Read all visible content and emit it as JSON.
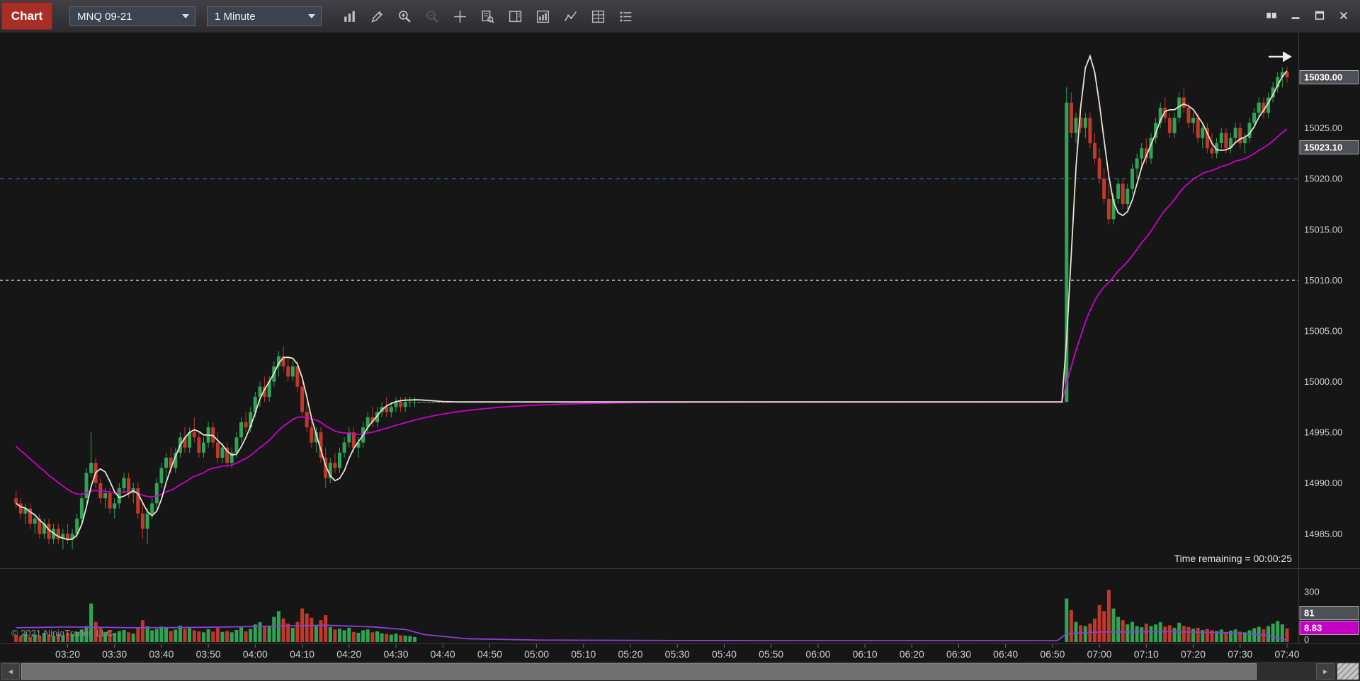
{
  "window": {
    "tab_label": "Chart",
    "toolbar": {
      "instrument_selector": {
        "value": "MNQ 09-21"
      },
      "interval_selector": {
        "value": "1 Minute"
      },
      "icons": [
        {
          "name": "chart-style"
        },
        {
          "name": "drawing-tools"
        },
        {
          "name": "zoom-in"
        },
        {
          "name": "zoom-out",
          "disabled": true
        },
        {
          "name": "crosshair"
        },
        {
          "name": "data-box"
        },
        {
          "name": "chart-trader"
        },
        {
          "name": "indicators"
        },
        {
          "name": "trend-lines"
        },
        {
          "name": "strategies"
        },
        {
          "name": "properties"
        }
      ],
      "window_buttons": [
        {
          "name": "windows"
        },
        {
          "name": "minimize"
        },
        {
          "name": "maximize"
        },
        {
          "name": "close"
        }
      ]
    }
  },
  "status": {
    "time_remaining": "Time remaining = 00:00:25",
    "copyright": "© 2021 NinjaTrader, LLC"
  },
  "scrollbar": {
    "left_arrow": "◄",
    "right_arrow": "►"
  },
  "chart_data": {
    "type": "candlestick",
    "instrument": "MNQ 09-21",
    "interval": "1 Minute",
    "price_axis": {
      "min": 14981.6,
      "max": 15034.4,
      "ticks": [
        {
          "value": 15030,
          "label": "15030.00"
        },
        {
          "value": 15025,
          "label": "15025.00"
        },
        {
          "value": 15020,
          "label": "15020.00"
        },
        {
          "value": 15015,
          "label": "15015.00"
        },
        {
          "value": 15010,
          "label": "15010.00"
        },
        {
          "value": 15005,
          "label": "15005.00"
        },
        {
          "value": 15000,
          "label": "15000.00"
        },
        {
          "value": 14995,
          "label": "14995.00"
        },
        {
          "value": 14990,
          "label": "14990.00"
        },
        {
          "value": 14985,
          "label": "14985.00"
        }
      ],
      "markers": [
        {
          "value": 15030.0,
          "label": "15030.00",
          "bg": "#4d5055",
          "fg": "#ffffff"
        },
        {
          "value": 15023.1,
          "label": "15023.10",
          "bg": "#4d5055",
          "fg": "#ffffff"
        }
      ]
    },
    "time_axis": {
      "labels": [
        "03:20",
        "03:30",
        "03:40",
        "03:50",
        "04:00",
        "04:10",
        "04:20",
        "04:30",
        "04:40",
        "04:50",
        "05:00",
        "05:10",
        "05:20",
        "05:30",
        "05:40",
        "05:50",
        "06:00",
        "06:10",
        "06:20",
        "06:30",
        "06:40",
        "06:50",
        "07:00",
        "07:10",
        "07:20",
        "07:30",
        "07:40"
      ],
      "minutes_per_label": 10
    },
    "hlines": [
      {
        "price": 15020.0,
        "color": "#3c6ea8",
        "dash": "6 5"
      },
      {
        "price": 15010.0,
        "color": "#e0e0e0",
        "dash": "4 4"
      }
    ],
    "overlays": [
      {
        "name": "fast-ma",
        "type": "hma",
        "period": 12,
        "color": "#e8e3d3",
        "width": 1.8
      },
      {
        "name": "slow-ma",
        "type": "ema",
        "period": 30,
        "seed": 14994,
        "color": "#cc00cc",
        "width": 1.8
      }
    ],
    "flat_segment": {
      "from": 75,
      "to": 212,
      "price": 14998.0,
      "volume": 1
    },
    "bars": [
      [
        -11,
        14988.5,
        14989.25,
        14987.5,
        14988,
        40
      ],
      [
        -10,
        14988,
        14988.5,
        14986.5,
        14987,
        35
      ],
      [
        -9,
        14987,
        14988,
        14986,
        14987.5,
        50
      ],
      [
        -8,
        14987.5,
        14988,
        14985.5,
        14986,
        30
      ],
      [
        -7,
        14986,
        14987,
        14985,
        14986.5,
        45
      ],
      [
        -6,
        14986.5,
        14987,
        14984.5,
        14985,
        38
      ],
      [
        -5,
        14985,
        14986.5,
        14984.5,
        14986,
        55
      ],
      [
        -4,
        14986,
        14986.5,
        14984,
        14984.5,
        42
      ],
      [
        -3,
        14984.5,
        14986,
        14984,
        14985.5,
        36
      ],
      [
        -2,
        14985.5,
        14986,
        14984,
        14984.5,
        48
      ],
      [
        -1,
        14984.5,
        14985.5,
        14983.5,
        14985,
        40
      ],
      [
        0,
        14985,
        14986,
        14984,
        14984.5,
        55
      ],
      [
        1,
        14984.5,
        14985.5,
        14983.5,
        14985,
        48
      ],
      [
        2,
        14985,
        14987,
        14984.5,
        14986.5,
        60
      ],
      [
        3,
        14986.5,
        14989,
        14986,
        14988.5,
        75
      ],
      [
        4,
        14988.5,
        14991.5,
        14988,
        14991,
        95
      ],
      [
        5,
        14991,
        14995,
        14990.5,
        14992,
        230
      ],
      [
        6,
        14992,
        14992.5,
        14989.5,
        14990,
        120
      ],
      [
        7,
        14990,
        14990.5,
        14988,
        14988.5,
        85
      ],
      [
        8,
        14988.5,
        14989.5,
        14987.5,
        14989,
        60
      ],
      [
        9,
        14989,
        14989.5,
        14987,
        14987.5,
        70
      ],
      [
        10,
        14987.5,
        14988.5,
        14986.5,
        14988,
        55
      ],
      [
        11,
        14988,
        14990,
        14987.5,
        14989.5,
        65
      ],
      [
        12,
        14989.5,
        14991,
        14989,
        14990.5,
        72
      ],
      [
        13,
        14990.5,
        14991,
        14988.5,
        14989,
        58
      ],
      [
        14,
        14989,
        14990,
        14988,
        14989.5,
        50
      ],
      [
        15,
        14989.5,
        14990,
        14986.5,
        14987,
        88
      ],
      [
        16,
        14987,
        14988,
        14984.5,
        14985.5,
        130
      ],
      [
        17,
        14985.5,
        14987.5,
        14984,
        14987,
        95
      ],
      [
        18,
        14987,
        14988.5,
        14986.5,
        14988,
        70
      ],
      [
        19,
        14988,
        14990.5,
        14987.5,
        14990,
        78
      ],
      [
        20,
        14990,
        14992,
        14989.5,
        14991.5,
        92
      ],
      [
        21,
        14991.5,
        14993,
        14990.5,
        14992.5,
        85
      ],
      [
        22,
        14992.5,
        14993.5,
        14991,
        14991.5,
        66
      ],
      [
        23,
        14991.5,
        14993.5,
        14991,
        14993,
        74
      ],
      [
        24,
        14993,
        14995,
        14992.5,
        14994.5,
        98
      ],
      [
        25,
        14994.5,
        14995.5,
        14993,
        14993.5,
        80
      ],
      [
        26,
        14993.5,
        14995.5,
        14993,
        14995,
        86
      ],
      [
        27,
        14995,
        14996.5,
        14994,
        14994.5,
        70
      ],
      [
        28,
        14994.5,
        14995,
        14992.5,
        14993,
        64
      ],
      [
        29,
        14993,
        14994.5,
        14992.5,
        14994,
        58
      ],
      [
        30,
        14994,
        14996,
        14993.5,
        14995.5,
        76
      ],
      [
        31,
        14995.5,
        14996,
        14993.5,
        14994,
        62
      ],
      [
        32,
        14994,
        14995,
        14992,
        14992.5,
        84
      ],
      [
        33,
        14992.5,
        14994,
        14992,
        14993.5,
        60
      ],
      [
        34,
        14993.5,
        14994,
        14991.5,
        14992,
        66
      ],
      [
        35,
        14992,
        14993.5,
        14991.5,
        14993,
        58
      ],
      [
        36,
        14993,
        14995,
        14992.5,
        14994.5,
        72
      ],
      [
        37,
        14994.5,
        14996.5,
        14994,
        14996,
        88
      ],
      [
        38,
        14996,
        14997,
        14995,
        14995.5,
        64
      ],
      [
        39,
        14995.5,
        14997.5,
        14995,
        14997,
        78
      ],
      [
        40,
        14997,
        14999,
        14996.5,
        14998.5,
        105
      ],
      [
        41,
        14998.5,
        15000,
        14997.5,
        14999.5,
        118
      ],
      [
        42,
        14999.5,
        15000.5,
        14998,
        14998.5,
        90
      ],
      [
        43,
        14998.5,
        15000.5,
        14998,
        15000,
        96
      ],
      [
        44,
        15000,
        15002,
        14999.5,
        15001.5,
        150
      ],
      [
        45,
        15001.5,
        15003,
        15000.5,
        15002.5,
        185
      ],
      [
        46,
        15002.5,
        15003.5,
        15001,
        15001.5,
        140
      ],
      [
        47,
        15001.5,
        15002.5,
        15000,
        15000.5,
        110
      ],
      [
        48,
        15000.5,
        15002,
        15000,
        15001.5,
        85
      ],
      [
        49,
        15001.5,
        15002,
        14999,
        14999.5,
        120
      ],
      [
        50,
        14999.5,
        15000,
        14996.5,
        14997,
        200
      ],
      [
        51,
        14997,
        14998,
        14995,
        14995.5,
        170
      ],
      [
        52,
        14995.5,
        14996.5,
        14993.5,
        14994,
        145
      ],
      [
        53,
        14994,
        14995.5,
        14993,
        14995,
        95
      ],
      [
        54,
        14995,
        14995.5,
        14992,
        14992.5,
        130
      ],
      [
        55,
        14992.5,
        14993.5,
        14989.5,
        14990.5,
        160
      ],
      [
        56,
        14990.5,
        14992.5,
        14990,
        14992,
        90
      ],
      [
        57,
        14992,
        14993,
        14991,
        14991.5,
        75
      ],
      [
        58,
        14991.5,
        14993.5,
        14991,
        14993,
        80
      ],
      [
        59,
        14993,
        14994.5,
        14992.5,
        14994,
        70
      ],
      [
        60,
        14994,
        14995.5,
        14993.5,
        14995,
        85
      ],
      [
        61,
        14995,
        14995.5,
        14993,
        14993.5,
        60
      ],
      [
        62,
        14993.5,
        14994.5,
        14992.5,
        14994,
        55
      ],
      [
        63,
        14994,
        14996,
        14993.5,
        14995.5,
        70
      ],
      [
        64,
        14995.5,
        14997,
        14995,
        14996.5,
        75
      ],
      [
        65,
        14996.5,
        14997.5,
        14995.5,
        14996,
        58
      ],
      [
        66,
        14996,
        14997.5,
        14995.5,
        14997,
        64
      ],
      [
        67,
        14997,
        14998,
        14996.5,
        14997.5,
        52
      ],
      [
        68,
        14997.5,
        14998.5,
        14996.5,
        14997,
        48
      ],
      [
        69,
        14997,
        14998,
        14996.5,
        14997.5,
        44
      ],
      [
        70,
        14997.5,
        14998.5,
        14997,
        14998,
        50
      ],
      [
        71,
        14998,
        14998.5,
        14997,
        14997.5,
        40
      ],
      [
        72,
        14997.5,
        14998.5,
        14997,
        14998,
        38
      ],
      [
        73,
        14998,
        14998.5,
        14997.5,
        14998,
        35
      ],
      [
        74,
        14998,
        14998.5,
        14997.5,
        14998,
        30
      ],
      [
        213,
        14998,
        15029,
        14998,
        15027.5,
        260
      ],
      [
        214,
        15027.5,
        15028.5,
        15024,
        15024.5,
        190
      ],
      [
        215,
        15024.5,
        15026.5,
        15023.5,
        15026,
        120
      ],
      [
        216,
        15026,
        15027,
        15024.5,
        15025,
        100
      ],
      [
        217,
        15025,
        15026.5,
        15024,
        15026,
        95
      ],
      [
        218,
        15026,
        15026.5,
        15023,
        15023.5,
        110
      ],
      [
        219,
        15023.5,
        15024.5,
        15021.5,
        15022,
        140
      ],
      [
        220,
        15022,
        15023,
        15019.5,
        15020,
        220
      ],
      [
        221,
        15020,
        15021,
        15017.5,
        15018,
        185
      ],
      [
        222,
        15018,
        15019.5,
        15015.5,
        15016,
        310
      ],
      [
        223,
        15016,
        15018.5,
        15015.5,
        15018,
        200
      ],
      [
        224,
        15018,
        15020,
        15017.5,
        15019.5,
        150
      ],
      [
        225,
        15019.5,
        15020,
        15017,
        15017.5,
        130
      ],
      [
        226,
        15017.5,
        15019.5,
        15017,
        15019,
        105
      ],
      [
        227,
        15019,
        15021.5,
        15018.5,
        15021,
        120
      ],
      [
        228,
        15021,
        15022.5,
        15020,
        15022,
        95
      ],
      [
        229,
        15022,
        15023.5,
        15021,
        15023,
        88
      ],
      [
        230,
        15023,
        15024,
        15021.5,
        15022,
        110
      ],
      [
        231,
        15022,
        15024.5,
        15021.5,
        15024,
        95
      ],
      [
        232,
        15024,
        15026,
        15023.5,
        15025.5,
        105
      ],
      [
        233,
        15025.5,
        15027.5,
        15025,
        15027,
        118
      ],
      [
        234,
        15027,
        15028,
        15025.5,
        15026,
        92
      ],
      [
        235,
        15026,
        15026.5,
        15024,
        15024.5,
        100
      ],
      [
        236,
        15024.5,
        15026.5,
        15024,
        15026,
        85
      ],
      [
        237,
        15026,
        15028.5,
        15025.5,
        15028,
        115
      ],
      [
        238,
        15028,
        15029,
        15026.5,
        15027,
        96
      ],
      [
        239,
        15027,
        15027.5,
        15025,
        15025.5,
        90
      ],
      [
        240,
        15025.5,
        15026.5,
        15024.5,
        15026,
        80
      ],
      [
        241,
        15026,
        15026.5,
        15023.5,
        15024,
        85
      ],
      [
        242,
        15024,
        15025.5,
        15023,
        15025,
        72
      ],
      [
        243,
        15025,
        15025.5,
        15022.5,
        15023,
        78
      ],
      [
        244,
        15023,
        15024.5,
        15022,
        15022.5,
        70
      ],
      [
        245,
        15022.5,
        15024,
        15022,
        15023.5,
        66
      ],
      [
        246,
        15023.5,
        15025,
        15023,
        15024.5,
        74
      ],
      [
        247,
        15024.5,
        15025,
        15022.5,
        15023,
        60
      ],
      [
        248,
        15023,
        15024.5,
        15022.5,
        15024,
        68
      ],
      [
        249,
        15024,
        15025.5,
        15023.5,
        15025,
        75
      ],
      [
        250,
        15025,
        15025.5,
        15023,
        15023.5,
        62
      ],
      [
        251,
        15023.5,
        15024.5,
        15022.5,
        15024,
        58
      ],
      [
        252,
        15024,
        15026,
        15023.5,
        15025.5,
        70
      ],
      [
        253,
        15025.5,
        15027,
        15025,
        15026.5,
        82
      ],
      [
        254,
        15026.5,
        15028,
        15026,
        15027.5,
        90
      ],
      [
        255,
        15027.5,
        15028,
        15026,
        15026.5,
        76
      ],
      [
        256,
        15026.5,
        15028.5,
        15026,
        15028,
        95
      ],
      [
        257,
        15028,
        15029.5,
        15027.5,
        15029,
        110
      ],
      [
        258,
        15029,
        15030.5,
        15028.5,
        15030,
        125
      ],
      [
        259,
        15030,
        15031,
        15029,
        15030.5,
        105
      ],
      [
        260,
        15030.5,
        15031,
        15029.5,
        15030,
        81
      ]
    ],
    "volume_pane": {
      "axis_ticks": [
        {
          "value": 300,
          "label": "300"
        },
        {
          "value": 0,
          "label": "0"
        }
      ],
      "markers": [
        {
          "value": 81,
          "label": "81",
          "bg": "#4d5055",
          "fg": "#ffffff"
        },
        {
          "value": 8.83,
          "label": "8.83",
          "bg": "#c400c4",
          "fg": "#ffffff"
        }
      ],
      "overlay": {
        "name": "volume-ma",
        "color": "#8a3fd6",
        "points": [
          [
            -11,
            85
          ],
          [
            0,
            90
          ],
          [
            15,
            85
          ],
          [
            30,
            88
          ],
          [
            45,
            95
          ],
          [
            55,
            100
          ],
          [
            65,
            90
          ],
          [
            72,
            75
          ],
          [
            76,
            45
          ],
          [
            85,
            20
          ],
          [
            100,
            12
          ],
          [
            130,
            9
          ],
          [
            211,
            8
          ],
          [
            213,
            50
          ],
          [
            220,
            60
          ],
          [
            235,
            62
          ],
          [
            248,
            55
          ],
          [
            256,
            40
          ],
          [
            260,
            8.83
          ]
        ]
      }
    },
    "colors": {
      "background": "#161616",
      "up": "#2fa455",
      "down": "#c0392b",
      "flat": "#8f8f8f",
      "axis_text": "#cfcfcf",
      "divider": "#3c3c3c",
      "arrow": "#ececec"
    }
  }
}
